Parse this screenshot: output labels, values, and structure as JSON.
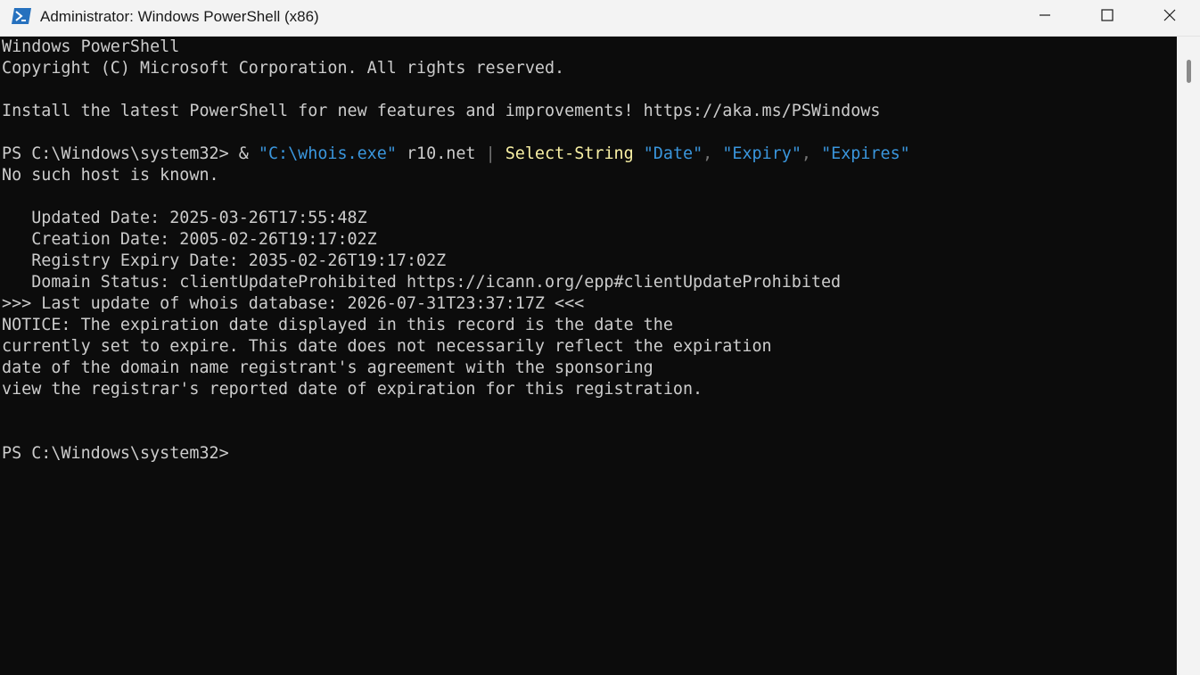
{
  "window": {
    "title": "Administrator: Windows PowerShell (x86)"
  },
  "icons": {
    "app": "powershell-icon",
    "minimize": "minimize-icon",
    "maximize": "maximize-icon",
    "close": "close-icon"
  },
  "colors": {
    "background": "#0c0c0c",
    "foreground": "#cccccc",
    "string": "#3a96dd",
    "command": "#f9f1a5",
    "operator": "#767676",
    "titlebar": "#f3f3f3"
  },
  "console": {
    "banner1": "Windows PowerShell",
    "banner2": "Copyright (C) Microsoft Corporation. All rights reserved.",
    "install_msg": "Install the latest PowerShell for new features and improvements! https://aka.ms/PSWindows",
    "command": {
      "prompt": "PS C:\\Windows\\system32> ",
      "amp": "& ",
      "exe": "\"C:\\whois.exe\"",
      "arg": " r10.net ",
      "pipe": "|",
      "space1": " ",
      "cmdlet": "Select-String",
      "space2": " ",
      "p1": "\"Date\"",
      "comma1": ", ",
      "p2": "\"Expiry\"",
      "comma2": ", ",
      "p3": "\"Expires\""
    },
    "output": [
      "No such host is known.",
      "",
      "   Updated Date: 2025-03-26T17:55:48Z",
      "   Creation Date: 2005-02-26T19:17:02Z",
      "   Registry Expiry Date: 2035-02-26T19:17:02Z",
      "   Domain Status: clientUpdateProhibited https://icann.org/epp#clientUpdateProhibited",
      ">>> Last update of whois database: 2026-07-31T23:37:17Z <<<",
      "NOTICE: The expiration date displayed in this record is the date the",
      "currently set to expire. This date does not necessarily reflect the expiration",
      "date of the domain name registrant's agreement with the sponsoring",
      "view the registrar's reported date of expiration for this registration."
    ],
    "final_prompt": "PS C:\\Windows\\system32>"
  }
}
